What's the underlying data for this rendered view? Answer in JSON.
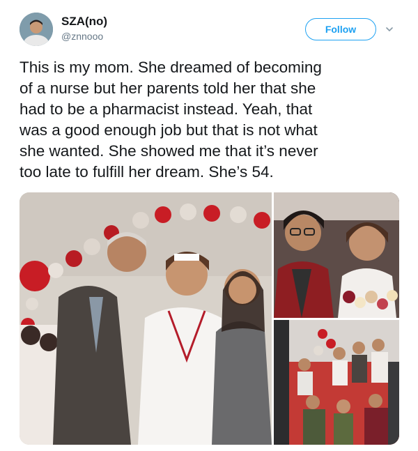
{
  "user": {
    "name": "SZA(no)",
    "handle": "@znnooo"
  },
  "follow_button": {
    "label": "Follow"
  },
  "menu": {
    "icon": "chevron-down-icon"
  },
  "tweet": {
    "lines": [
      "This is my mom. She dreamed of becoming",
      "of a nurse but her parents told her that she",
      "had to be a pharmacist instead. Yeah, that",
      "was a good enough job but that is not what",
      "she wanted. She showed me that it’s never",
      "too late to fulfill her dream. She’s 54."
    ]
  },
  "colors": {
    "accent": "#1da1f2",
    "text": "#14171a",
    "secondary_text": "#657786"
  }
}
